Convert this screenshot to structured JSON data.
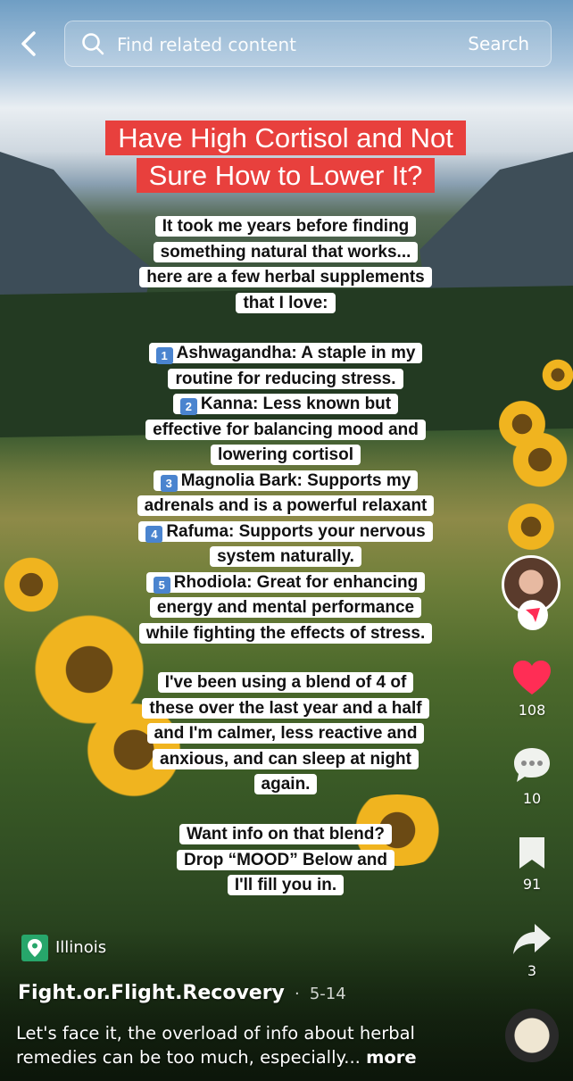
{
  "search": {
    "placeholder": "Find related content",
    "button_label": "Search"
  },
  "video": {
    "headline": [
      "Have High Cortisol and Not",
      "Sure How to Lower It?"
    ],
    "intro": [
      "It took me years before finding",
      "something natural that works...",
      "here are a few herbal supplements",
      "that I love:"
    ],
    "items": [
      {
        "n": "1",
        "lines": [
          "Ashwagandha: A staple in my",
          "routine for reducing stress."
        ]
      },
      {
        "n": "2",
        "lines": [
          "Kanna: Less known but",
          "effective for balancing mood and",
          "lowering cortisol"
        ]
      },
      {
        "n": "3",
        "lines": [
          "Magnolia Bark: Supports my",
          "adrenals and is a powerful relaxant"
        ]
      },
      {
        "n": "4",
        "lines": [
          "Rafuma: Supports your nervous",
          "system naturally."
        ]
      },
      {
        "n": "5",
        "lines": [
          "Rhodiola: Great for enhancing",
          "energy and mental performance",
          "while fighting the effects of stress."
        ]
      }
    ],
    "blend": [
      "I've been using a blend of 4 of",
      "these over the last year and a half",
      "and I'm calmer, less reactive and",
      "anxious, and can sleep at night",
      "again."
    ],
    "cta": [
      "Want info on that blend?",
      "Drop “MOOD” Below and",
      "I'll fill you in."
    ]
  },
  "rail": {
    "likes": "108",
    "comments": "10",
    "saves": "91",
    "shares": "3"
  },
  "post": {
    "location": "Illinois",
    "author": "Fight.or.Flight.Recovery",
    "separator": "·",
    "date": "5-14",
    "description": "Let's face it, the overload of info about herbal remedies can be too much, especially...",
    "more_label": "more"
  },
  "colors": {
    "headline_bg": "#e8403d",
    "like": "#ff2d55",
    "number_badge": "#4a84cf",
    "location_badge": "#27a66b"
  }
}
